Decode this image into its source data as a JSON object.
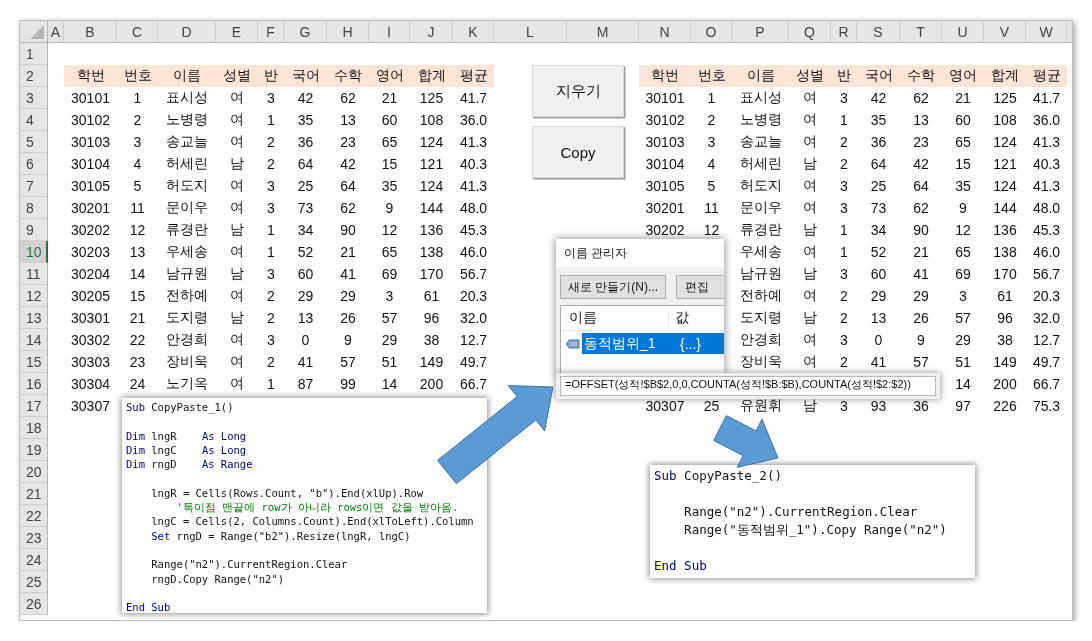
{
  "sheet": {
    "columns": [
      "A",
      "B",
      "C",
      "D",
      "E",
      "F",
      "G",
      "H",
      "I",
      "J",
      "K",
      "L",
      "M",
      "N",
      "O",
      "P",
      "Q",
      "R",
      "S",
      "T",
      "U",
      "V",
      "W"
    ],
    "row_headers": [
      {
        "label": "1",
        "selected": false
      },
      {
        "label": "2",
        "selected": false
      },
      {
        "label": "3",
        "selected": false
      },
      {
        "label": "4",
        "selected": false
      },
      {
        "label": "5",
        "selected": false
      },
      {
        "label": "6",
        "selected": false
      },
      {
        "label": "7",
        "selected": false
      },
      {
        "label": "8",
        "selected": false
      },
      {
        "label": "9",
        "selected": false
      },
      {
        "label": "10",
        "selected": true
      },
      {
        "label": "11",
        "selected": false
      },
      {
        "label": "12",
        "selected": false
      },
      {
        "label": "13",
        "selected": false
      },
      {
        "label": "14",
        "selected": false
      },
      {
        "label": "15",
        "selected": false
      },
      {
        "label": "16",
        "selected": false
      },
      {
        "label": "17",
        "selected": false
      },
      {
        "label": "18",
        "selected": false
      },
      {
        "label": "19",
        "selected": false
      },
      {
        "label": "20",
        "selected": false
      },
      {
        "label": "21",
        "selected": false
      },
      {
        "label": "22",
        "selected": false
      },
      {
        "label": "23",
        "selected": false
      },
      {
        "label": "24",
        "selected": false
      },
      {
        "label": "25",
        "selected": false
      },
      {
        "label": "26",
        "selected": false
      }
    ],
    "header_cells": {
      "B2": "학번",
      "C2": "번호",
      "D2": "이름",
      "E2": "성별",
      "F2": "반",
      "G2": "국어",
      "H2": "수학",
      "I2": "영어",
      "J2": "합계",
      "K2": "평균",
      "N2": "학번",
      "O2": "번호",
      "P2": "이름",
      "Q2": "성별",
      "R2": "반",
      "S2": "국어",
      "T2": "수학",
      "U2": "영어",
      "V2": "합계",
      "W2": "평균"
    },
    "cells": {
      "B3": "30101",
      "C3": "1",
      "D3": "표시성",
      "E3": "여",
      "F3": "3",
      "G3": "42",
      "H3": "62",
      "I3": "21",
      "J3": "125",
      "K3": "41.7",
      "N3": "30101",
      "O3": "1",
      "P3": "표시성",
      "Q3": "여",
      "R3": "3",
      "S3": "42",
      "T3": "62",
      "U3": "21",
      "V3": "125",
      "W3": "41.7",
      "B4": "30102",
      "C4": "2",
      "D4": "노병령",
      "E4": "여",
      "F4": "1",
      "G4": "35",
      "H4": "13",
      "I4": "60",
      "J4": "108",
      "K4": "36.0",
      "N4": "30102",
      "O4": "2",
      "P4": "노병령",
      "Q4": "여",
      "R4": "1",
      "S4": "35",
      "T4": "13",
      "U4": "60",
      "V4": "108",
      "W4": "36.0",
      "B5": "30103",
      "C5": "3",
      "D5": "송교늘",
      "E5": "여",
      "F5": "2",
      "G5": "36",
      "H5": "23",
      "I5": "65",
      "J5": "124",
      "K5": "41.3",
      "N5": "30103",
      "O5": "3",
      "P5": "송교늘",
      "Q5": "여",
      "R5": "2",
      "S5": "36",
      "T5": "23",
      "U5": "65",
      "V5": "124",
      "W5": "41.3",
      "B6": "30104",
      "C6": "4",
      "D6": "허세린",
      "E6": "남",
      "F6": "2",
      "G6": "64",
      "H6": "42",
      "I6": "15",
      "J6": "121",
      "K6": "40.3",
      "N6": "30104",
      "O6": "4",
      "P6": "허세린",
      "Q6": "남",
      "R6": "2",
      "S6": "64",
      "T6": "42",
      "U6": "15",
      "V6": "121",
      "W6": "40.3",
      "B7": "30105",
      "C7": "5",
      "D7": "허도지",
      "E7": "여",
      "F7": "3",
      "G7": "25",
      "H7": "64",
      "I7": "35",
      "J7": "124",
      "K7": "41.3",
      "N7": "30105",
      "O7": "5",
      "P7": "허도지",
      "Q7": "여",
      "R7": "3",
      "S7": "25",
      "T7": "64",
      "U7": "35",
      "V7": "124",
      "W7": "41.3",
      "B8": "30201",
      "C8": "11",
      "D8": "문이우",
      "E8": "여",
      "F8": "3",
      "G8": "73",
      "H8": "62",
      "I8": "9",
      "J8": "144",
      "K8": "48.0",
      "N8": "30201",
      "O8": "11",
      "P8": "문이우",
      "Q8": "여",
      "R8": "3",
      "S8": "73",
      "T8": "62",
      "U8": "9",
      "V8": "144",
      "W8": "48.0",
      "B9": "30202",
      "C9": "12",
      "D9": "류경란",
      "E9": "남",
      "F9": "1",
      "G9": "34",
      "H9": "90",
      "I9": "12",
      "J9": "136",
      "K9": "45.3",
      "N9": "30202",
      "O9": "12",
      "P9": "류경란",
      "Q9": "남",
      "R9": "1",
      "S9": "34",
      "T9": "90",
      "U9": "12",
      "V9": "136",
      "W9": "45.3",
      "B10": "30203",
      "C10": "13",
      "D10": "우세송",
      "E10": "여",
      "F10": "1",
      "G10": "52",
      "H10": "21",
      "I10": "65",
      "J10": "138",
      "K10": "46.0",
      "P10": "우세송",
      "Q10": "여",
      "R10": "1",
      "S10": "52",
      "T10": "21",
      "U10": "65",
      "V10": "138",
      "W10": "46.0",
      "B11": "30204",
      "C11": "14",
      "D11": "남규원",
      "E11": "남",
      "F11": "3",
      "G11": "60",
      "H11": "41",
      "I11": "69",
      "J11": "170",
      "K11": "56.7",
      "P11": "남규원",
      "Q11": "남",
      "R11": "3",
      "S11": "60",
      "T11": "41",
      "U11": "69",
      "V11": "170",
      "W11": "56.7",
      "B12": "30205",
      "C12": "15",
      "D12": "전하예",
      "E12": "여",
      "F12": "2",
      "G12": "29",
      "H12": "29",
      "I12": "3",
      "J12": "61",
      "K12": "20.3",
      "P12": "전하예",
      "Q12": "여",
      "R12": "2",
      "S12": "29",
      "T12": "29",
      "U12": "3",
      "V12": "61",
      "W12": "20.3",
      "B13": "30301",
      "C13": "21",
      "D13": "도지령",
      "E13": "남",
      "F13": "2",
      "G13": "13",
      "H13": "26",
      "I13": "57",
      "J13": "96",
      "K13": "32.0",
      "P13": "도지령",
      "Q13": "남",
      "R13": "2",
      "S13": "13",
      "T13": "26",
      "U13": "57",
      "V13": "96",
      "W13": "32.0",
      "B14": "30302",
      "C14": "22",
      "D14": "안경희",
      "E14": "여",
      "F14": "3",
      "G14": "0",
      "H14": "9",
      "I14": "29",
      "J14": "38",
      "K14": "12.7",
      "P14": "안경희",
      "Q14": "여",
      "R14": "3",
      "S14": "0",
      "T14": "9",
      "U14": "29",
      "V14": "38",
      "W14": "12.7",
      "B15": "30303",
      "C15": "23",
      "D15": "장비욱",
      "E15": "여",
      "F15": "2",
      "G15": "41",
      "H15": "57",
      "I15": "51",
      "J15": "149",
      "K15": "49.7",
      "P15": "장비욱",
      "Q15": "여",
      "R15": "2",
      "S15": "41",
      "T15": "57",
      "U15": "51",
      "V15": "149",
      "W15": "49.7",
      "B16": "30304",
      "C16": "24",
      "D16": "노기옥",
      "E16": "여",
      "F16": "1",
      "G16": "87",
      "H16": "99",
      "I16": "14",
      "J16": "200",
      "K16": "66.7",
      "U16": "14",
      "V16": "200",
      "W16": "66.7",
      "B17": "30307",
      "N17": "30307",
      "O17": "25",
      "P17": "유원휘",
      "Q17": "남",
      "R17": "3",
      "S17": "93",
      "T17": "36",
      "U17": "97",
      "V17": "226",
      "W17": "75.3"
    }
  },
  "buttons": [
    "지우기",
    "Copy"
  ],
  "name_manager": {
    "title": "이름 관리자",
    "buttons": [
      "새로 만들기(N)...",
      "편집"
    ],
    "columns": [
      "이름",
      "값"
    ],
    "items": [
      {
        "name": "동적범위_1",
        "value": "{...}",
        "selected": true
      }
    ],
    "refers_to": "=OFFSET(성적!$B$2,0,0,COUNTA(성적!$B:$B),COUNTA(성적!$2:$2))"
  },
  "code_panels": [
    {
      "blocks": [
        [
          [
            {
              "kind": "keyword",
              "text": "Sub"
            },
            {
              "kind": "plain",
              "text": " CopyPaste_1()"
            }
          ]
        ],
        [
          [
            {
              "kind": "keyword",
              "text": "Dim"
            },
            {
              "kind": "plain",
              "text": " lngR    "
            },
            {
              "kind": "keyword",
              "text": "As Long"
            }
          ],
          [
            {
              "kind": "keyword",
              "text": "Dim"
            },
            {
              "kind": "plain",
              "text": " lngC    "
            },
            {
              "kind": "keyword",
              "text": "As Long"
            }
          ],
          [
            {
              "kind": "keyword",
              "text": "Dim"
            },
            {
              "kind": "plain",
              "text": " rngD    "
            },
            {
              "kind": "keyword",
              "text": "As Range"
            }
          ]
        ],
        [
          [
            {
              "kind": "plain",
              "text": "    lngR = Cells(Rows.Count, \"b\").End(xlUp).Row"
            }
          ],
          [
            {
              "kind": "comment",
              "text": "        '특이점 맨끝에 row가 아니라 rows이면 값을 받아옴."
            }
          ],
          [
            {
              "kind": "plain",
              "text": "    lngC = Cells(2, Columns.Count).End(xlToLeft).Column"
            }
          ],
          [
            {
              "kind": "keyword",
              "text": "    Set"
            },
            {
              "kind": "plain",
              "text": " rngD = Range(\"b2\").Resize(lngR, lngC)"
            }
          ]
        ],
        [
          [
            {
              "kind": "plain",
              "text": "    Range(\"n2\").CurrentRegion.Clear"
            }
          ],
          [
            {
              "kind": "plain",
              "text": "    rngD.Copy Range(\"n2\")"
            }
          ]
        ],
        [
          [
            {
              "kind": "keyword",
              "text": "End Sub"
            }
          ]
        ]
      ]
    },
    {
      "blocks": [
        [
          [
            {
              "kind": "keyword",
              "text": "Sub"
            },
            {
              "kind": "plain",
              "text": " CopyPaste_2()"
            }
          ]
        ],
        [
          [
            {
              "kind": "plain",
              "text": "    Range(\"n2\").CurrentRegion.Clear"
            }
          ],
          [
            {
              "kind": "plain",
              "text": "    Range(\"동적범위_1\").Copy Range(\"n2\")"
            }
          ]
        ],
        [
          [
            {
              "kind": "keyword",
              "text": "End Sub"
            }
          ]
        ]
      ]
    }
  ]
}
